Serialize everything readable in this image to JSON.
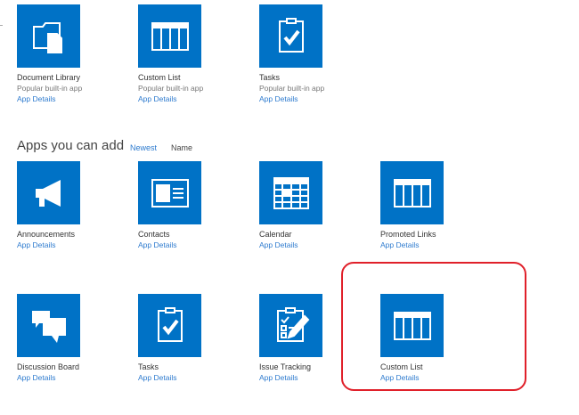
{
  "popular": [
    {
      "name": "Document Library",
      "subtitle": "Popular built-in app",
      "link": "App Details",
      "icon": "document-library-icon"
    },
    {
      "name": "Custom List",
      "subtitle": "Popular built-in app",
      "link": "App Details",
      "icon": "custom-list-icon"
    },
    {
      "name": "Tasks",
      "subtitle": "Popular built-in app",
      "link": "App Details",
      "icon": "tasks-icon"
    }
  ],
  "section": {
    "title": "Apps you can add",
    "sort_newest": "Newest",
    "sort_name": "Name"
  },
  "apps": [
    {
      "name": "Announcements",
      "link": "App Details",
      "icon": "megaphone-icon"
    },
    {
      "name": "Contacts",
      "link": "App Details",
      "icon": "contact-card-icon"
    },
    {
      "name": "Calendar",
      "link": "App Details",
      "icon": "calendar-icon"
    },
    {
      "name": "Promoted Links",
      "link": "App Details",
      "icon": "custom-list-icon"
    },
    {
      "name": "Discussion Board",
      "link": "App Details",
      "icon": "speech-bubbles-icon"
    },
    {
      "name": "Tasks",
      "link": "App Details",
      "icon": "tasks-icon"
    },
    {
      "name": "Issue Tracking",
      "link": "App Details",
      "icon": "issue-tracking-icon"
    },
    {
      "name": "Custom List",
      "link": "App Details",
      "icon": "custom-list-icon"
    }
  ],
  "colors": {
    "tile": "#0072c6",
    "link": "#2e7bcf",
    "highlight": "#e0202a"
  }
}
